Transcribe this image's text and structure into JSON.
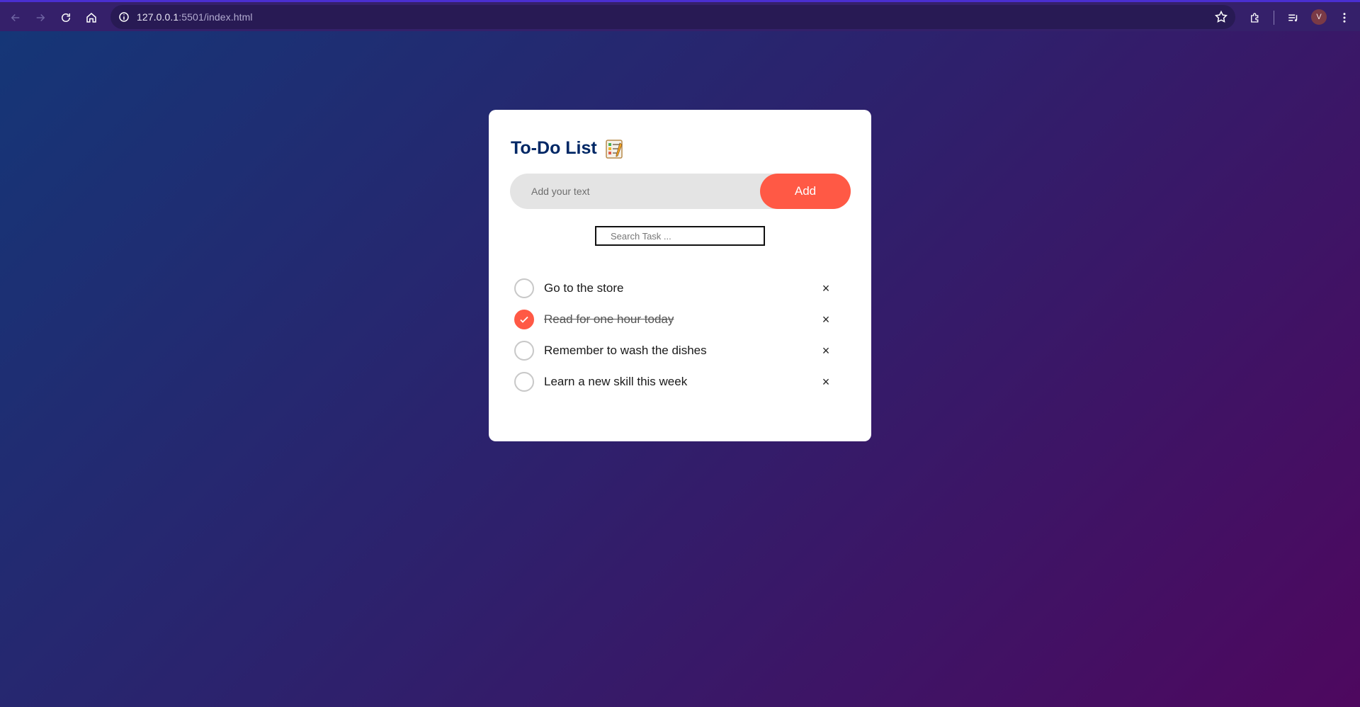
{
  "browser": {
    "url_host": "127.0.0.1",
    "url_rest": ":5501/index.html",
    "profile_initial": "V",
    "icons": [
      "back-arrow-icon",
      "forward-arrow-icon",
      "reload-icon",
      "home-icon",
      "info-icon",
      "star-icon",
      "extensions-icon",
      "media-controls-icon",
      "kebab-menu-icon"
    ]
  },
  "app": {
    "title": "To-Do List",
    "title_icon": "checklist-icon",
    "add_placeholder": "Add your text",
    "add_button": "Add",
    "search_placeholder": "Search Task ...",
    "delete_glyph": "×",
    "tasks": [
      {
        "text": "Go to the store",
        "done": false
      },
      {
        "text": "Read for one hour today",
        "done": true
      },
      {
        "text": "Remember to wash the dishes",
        "done": false
      },
      {
        "text": "Learn a new skill this week",
        "done": false
      }
    ]
  },
  "colors": {
    "accent": "#ff5945",
    "title": "#002765",
    "background_start": "#153677",
    "background_end": "#4e085f"
  }
}
